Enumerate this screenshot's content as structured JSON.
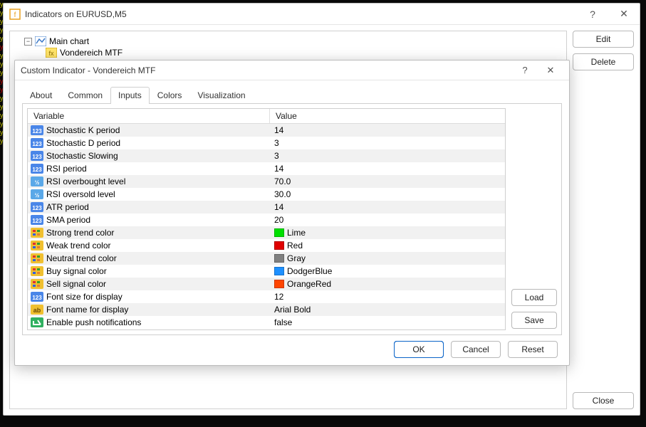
{
  "outer": {
    "title": "Indicators on EURUSD,M5",
    "edit_label": "Edit",
    "delete_label": "Delete",
    "close_label": "Close",
    "tree_main": "Main chart",
    "tree_indicator": "Vondereich MTF"
  },
  "dialog": {
    "title": "Custom Indicator - Vondereich MTF",
    "tabs": {
      "about": "About",
      "common": "Common",
      "inputs": "Inputs",
      "colors": "Colors",
      "visualization": "Visualization"
    },
    "headers": {
      "variable": "Variable",
      "value": "Value"
    },
    "rows": [
      {
        "type": "int",
        "name": "Stochastic K period",
        "value": "14"
      },
      {
        "type": "int",
        "name": "Stochastic D period",
        "value": "3"
      },
      {
        "type": "int",
        "name": "Stochastic Slowing",
        "value": "3"
      },
      {
        "type": "int",
        "name": "RSI period",
        "value": "14"
      },
      {
        "type": "float",
        "name": "RSI overbought level",
        "value": "70.0"
      },
      {
        "type": "float",
        "name": "RSI oversold level",
        "value": "30.0"
      },
      {
        "type": "int",
        "name": "ATR period",
        "value": "14"
      },
      {
        "type": "int",
        "name": "SMA period",
        "value": "20"
      },
      {
        "type": "color",
        "name": "Strong trend color",
        "value": "Lime",
        "swatch": "#00e000"
      },
      {
        "type": "color",
        "name": "Weak trend color",
        "value": "Red",
        "swatch": "#e00000"
      },
      {
        "type": "color",
        "name": "Neutral trend color",
        "value": "Gray",
        "swatch": "#808080"
      },
      {
        "type": "color",
        "name": "Buy signal color",
        "value": "DodgerBlue",
        "swatch": "#1e90ff"
      },
      {
        "type": "color",
        "name": "Sell signal color",
        "value": "OrangeRed",
        "swatch": "#ff4500"
      },
      {
        "type": "int",
        "name": "Font size for display",
        "value": "12"
      },
      {
        "type": "string",
        "name": "Font name for display",
        "value": "Arial Bold"
      },
      {
        "type": "bool",
        "name": "Enable push notifications",
        "value": "false"
      }
    ],
    "load_label": "Load",
    "save_label": "Save",
    "ok_label": "OK",
    "cancel_label": "Cancel",
    "reset_label": "Reset"
  }
}
